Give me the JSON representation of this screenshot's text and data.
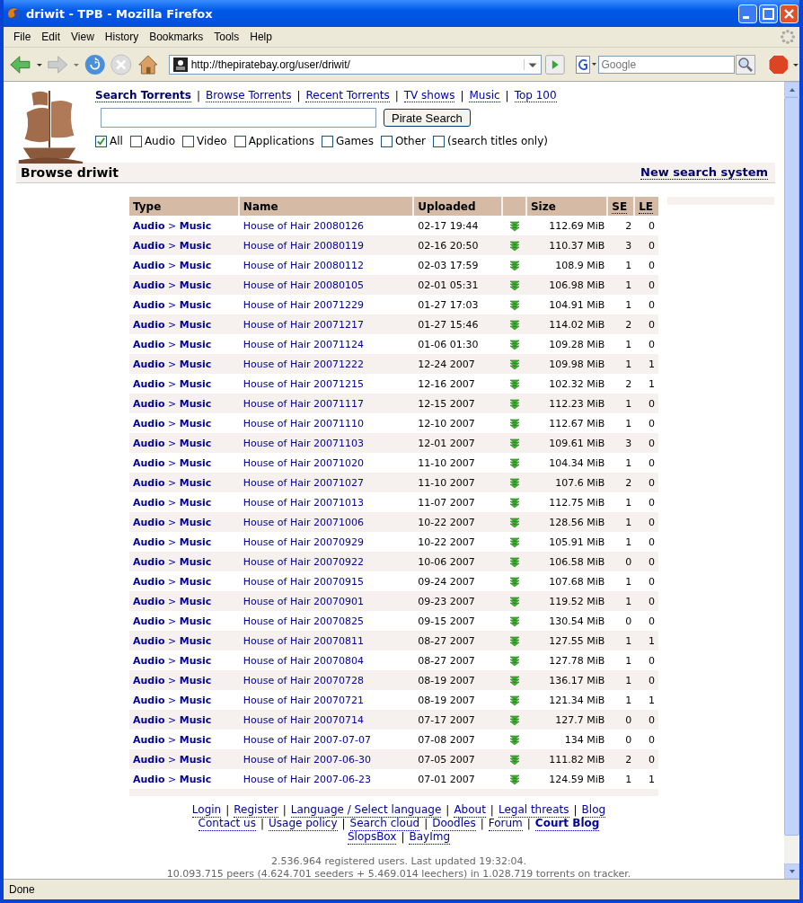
{
  "window": {
    "title": "driwit - TPB - Mozilla Firefox"
  },
  "menu": [
    "File",
    "Edit",
    "View",
    "History",
    "Bookmarks",
    "Tools",
    "Help"
  ],
  "address": {
    "value": "http://thepiratebay.org/user/driwit/"
  },
  "web_search": {
    "placeholder": "Google"
  },
  "nav_links": [
    {
      "label": "Search Torrents",
      "bold": true
    },
    {
      "label": "Browse Torrents",
      "bold": false
    },
    {
      "label": "Recent Torrents",
      "bold": false
    },
    {
      "label": "TV shows",
      "bold": false
    },
    {
      "label": "Music",
      "bold": false
    },
    {
      "label": "Top 100",
      "bold": false
    }
  ],
  "nav_separator": "|",
  "search": {
    "button": "Pirate Search"
  },
  "categories": [
    {
      "label": "All",
      "checked": true
    },
    {
      "label": "Audio",
      "checked": false
    },
    {
      "label": "Video",
      "checked": false
    },
    {
      "label": "Applications",
      "checked": false
    },
    {
      "label": "Games",
      "checked": false
    },
    {
      "label": "Other",
      "checked": false
    },
    {
      "label": "(search titles only)",
      "checked": false
    }
  ],
  "browse": {
    "title": "Browse driwit",
    "link": "New search system"
  },
  "table": {
    "columns": [
      {
        "kind": "text",
        "label": "Type"
      },
      {
        "kind": "text",
        "label": "Name"
      },
      {
        "kind": "text",
        "label": "Uploaded"
      },
      {
        "kind": "icon"
      },
      {
        "kind": "text",
        "label": "Size"
      },
      {
        "kind": "abbr",
        "label": "SE"
      },
      {
        "kind": "abbr",
        "label": "LE"
      }
    ],
    "rows": [
      {
        "type": "**Audio** > **Music**",
        "name": "House of Hair 20080126",
        "uploaded": "02-17 19:44",
        "size": "112.69 MiB",
        "se": "2",
        "le": "0"
      },
      {
        "type": "**Audio** > **Music**",
        "name": "House of Hair 20080119",
        "uploaded": "02-16 20:50",
        "size": "110.37 MiB",
        "se": "3",
        "le": "0"
      },
      {
        "type": "**Audio** > **Music**",
        "name": "House of Hair 20080112",
        "uploaded": "02-03 17:59",
        "size": "108.9 MiB",
        "se": "1",
        "le": "0"
      },
      {
        "type": "**Audio** > **Music**",
        "name": "House of Hair 20080105",
        "uploaded": "02-01 05:31",
        "size": "106.98 MiB",
        "se": "1",
        "le": "0"
      },
      {
        "type": "**Audio** > **Music**",
        "name": "House of Hair 20071229",
        "uploaded": "01-27 17:03",
        "size": "104.91 MiB",
        "se": "1",
        "le": "0"
      },
      {
        "type": "**Audio** > **Music**",
        "name": "House of Hair 20071217",
        "uploaded": "01-27 15:46",
        "size": "114.02 MiB",
        "se": "2",
        "le": "0"
      },
      {
        "type": "**Audio** > **Music**",
        "name": "House of Hair 20071124",
        "uploaded": "01-06 01:30",
        "size": "109.28 MiB",
        "se": "1",
        "le": "0"
      },
      {
        "type": "**Audio** > **Music**",
        "name": "House of Hair 20071222",
        "uploaded": "12-24 2007",
        "size": "109.98 MiB",
        "se": "1",
        "le": "1"
      },
      {
        "type": "**Audio** > **Music**",
        "name": "House of Hair 20071215",
        "uploaded": "12-16 2007",
        "size": "102.32 MiB",
        "se": "2",
        "le": "1"
      },
      {
        "type": "**Audio** > **Music**",
        "name": "House of Hair 20071117",
        "uploaded": "12-15 2007",
        "size": "112.23 MiB",
        "se": "1",
        "le": "0"
      },
      {
        "type": "**Audio** > **Music**",
        "name": "House of Hair 20071110",
        "uploaded": "12-10 2007",
        "size": "112.67 MiB",
        "se": "1",
        "le": "0"
      },
      {
        "type": "**Audio** > **Music**",
        "name": "House of Hair 20071103",
        "uploaded": "12-01 2007",
        "size": "109.61 MiB",
        "se": "3",
        "le": "0"
      },
      {
        "type": "**Audio** > **Music**",
        "name": "House of Hair 20071020",
        "uploaded": "11-10 2007",
        "size": "104.34 MiB",
        "se": "1",
        "le": "0"
      },
      {
        "type": "**Audio** > **Music**",
        "name": "House of Hair 20071027",
        "uploaded": "11-10 2007",
        "size": "107.6 MiB",
        "se": "2",
        "le": "0"
      },
      {
        "type": "**Audio** > **Music**",
        "name": "House of Hair 20071013",
        "uploaded": "11-07 2007",
        "size": "112.75 MiB",
        "se": "1",
        "le": "0"
      },
      {
        "type": "**Audio** > **Music**",
        "name": "House of Hair 20071006",
        "uploaded": "10-22 2007",
        "size": "128.56 MiB",
        "se": "1",
        "le": "0"
      },
      {
        "type": "**Audio** > **Music**",
        "name": "House of Hair 20070929",
        "uploaded": "10-22 2007",
        "size": "105.91 MiB",
        "se": "1",
        "le": "0"
      },
      {
        "type": "**Audio** > **Music**",
        "name": "House of Hair 20070922",
        "uploaded": "10-06 2007",
        "size": "106.58 MiB",
        "se": "0",
        "le": "0"
      },
      {
        "type": "**Audio** > **Music**",
        "name": "House of Hair 20070915",
        "uploaded": "09-24 2007",
        "size": "107.68 MiB",
        "se": "1",
        "le": "0"
      },
      {
        "type": "**Audio** > **Music**",
        "name": "House of Hair 20070901",
        "uploaded": "09-23 2007",
        "size": "119.52 MiB",
        "se": "1",
        "le": "0"
      },
      {
        "type": "**Audio** > **Music**",
        "name": "House of Hair 20070825",
        "uploaded": "09-15 2007",
        "size": "130.54 MiB",
        "se": "0",
        "le": "0"
      },
      {
        "type": "**Audio** > **Music**",
        "name": "House of Hair 20070811",
        "uploaded": "08-27 2007",
        "size": "127.55 MiB",
        "se": "1",
        "le": "1"
      },
      {
        "type": "**Audio** > **Music**",
        "name": "House of Hair 20070804",
        "uploaded": "08-27 2007",
        "size": "127.78 MiB",
        "se": "1",
        "le": "0"
      },
      {
        "type": "**Audio** > **Music**",
        "name": "House of Hair 20070728",
        "uploaded": "08-19 2007",
        "size": "136.17 MiB",
        "se": "1",
        "le": "0"
      },
      {
        "type": "**Audio** > **Music**",
        "name": "House of Hair 20070721",
        "uploaded": "08-19 2007",
        "size": "121.34 MiB",
        "se": "1",
        "le": "1"
      },
      {
        "type": "**Audio** > **Music**",
        "name": "House of Hair 20070714",
        "uploaded": "07-17 2007",
        "size": "127.7 MiB",
        "se": "0",
        "le": "0"
      },
      {
        "type": "**Audio** > **Music**",
        "name": "House of Hair 2007-07-07",
        "uploaded": "07-08 2007",
        "size": "134 MiB",
        "se": "0",
        "le": "0"
      },
      {
        "type": "**Audio** > **Music**",
        "name": "House of Hair 2007-06-30",
        "uploaded": "07-05 2007",
        "size": "111.82 MiB",
        "se": "2",
        "le": "0"
      },
      {
        "type": "**Audio** > **Music**",
        "name": "House of Hair 2007-06-23",
        "uploaded": "07-01 2007",
        "size": "124.59 MiB",
        "se": "1",
        "le": "1"
      }
    ]
  },
  "footer_links": [
    [
      {
        "label": "Login",
        "bold": false
      },
      {
        "label": "Register",
        "bold": false
      },
      {
        "label": "Language / Select language",
        "bold": false
      },
      {
        "label": "About",
        "bold": false
      },
      {
        "label": "Legal threats",
        "bold": false
      },
      {
        "label": "Blog",
        "bold": false
      }
    ],
    [
      {
        "label": "Contact us",
        "bold": false
      },
      {
        "label": "Usage policy",
        "bold": false
      },
      {
        "label": "Search cloud",
        "bold": false
      },
      {
        "label": "Doodles",
        "bold": false
      },
      {
        "label": "Forum",
        "bold": false
      },
      {
        "label": "Court Blog",
        "bold": true
      }
    ],
    [
      {
        "label": "SlopsBox",
        "bold": false
      },
      {
        "label": "BayImg",
        "bold": false
      }
    ]
  ],
  "stats": [
    "2.536.964 registered users. Last updated 19:32:04.",
    "10.093.715 peers (4.624.701 seeders + 5.469.014 leechers) in 1.028.719 torrents on tracker."
  ],
  "status_bar": "Done"
}
